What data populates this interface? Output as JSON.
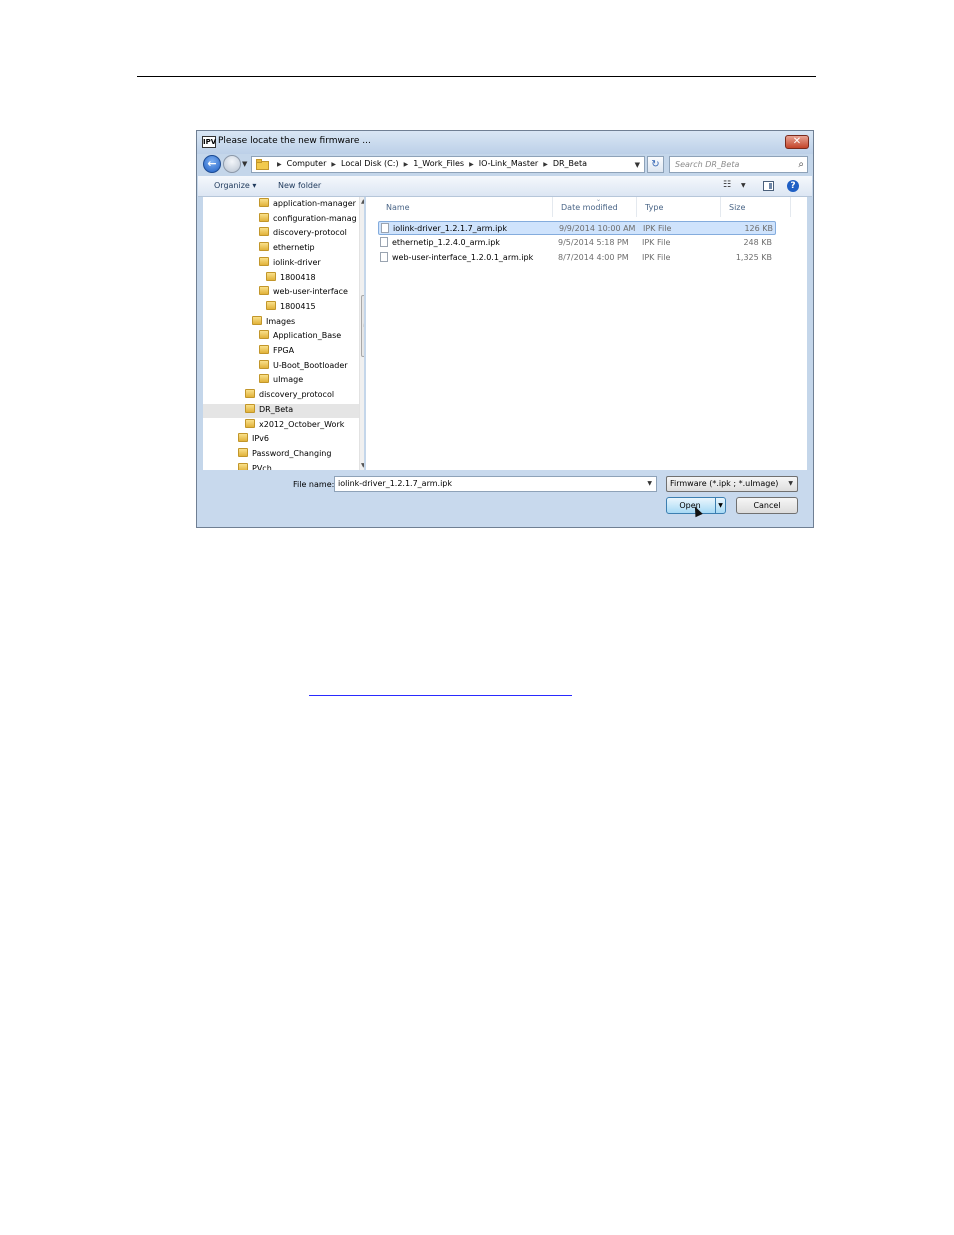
{
  "window": {
    "app_icon_text": "IPV",
    "title": "Please locate the new firmware ...",
    "close_glyph": "✕"
  },
  "nav": {
    "back_glyph": "←",
    "address_crumbs": [
      "Computer",
      "Local Disk (C:)",
      "1_Work_Files",
      "IO-Link_Master",
      "DR_Beta"
    ],
    "search_placeholder": "Search DR_Beta"
  },
  "toolbar": {
    "organize_label": "Organize ▾",
    "new_folder_label": "New folder",
    "help_glyph": "?"
  },
  "tree": {
    "items": [
      {
        "label": "application-manager",
        "indent": 3,
        "selected": false
      },
      {
        "label": "configuration-manag",
        "indent": 3,
        "selected": false
      },
      {
        "label": "discovery-protocol",
        "indent": 3,
        "selected": false
      },
      {
        "label": "ethernetip",
        "indent": 3,
        "selected": false
      },
      {
        "label": "iolink-driver",
        "indent": 3,
        "selected": false
      },
      {
        "label": "1800418",
        "indent": 4,
        "selected": false
      },
      {
        "label": "web-user-interface",
        "indent": 3,
        "selected": false
      },
      {
        "label": "1800415",
        "indent": 4,
        "selected": false
      },
      {
        "label": "Images",
        "indent": 2,
        "selected": false
      },
      {
        "label": "Application_Base",
        "indent": 3,
        "selected": false
      },
      {
        "label": "FPGA",
        "indent": 3,
        "selected": false
      },
      {
        "label": "U-Boot_Bootloader",
        "indent": 3,
        "selected": false
      },
      {
        "label": "uImage",
        "indent": 3,
        "selected": false
      },
      {
        "label": "discovery_protocol",
        "indent": 1,
        "selected": false
      },
      {
        "label": "DR_Beta",
        "indent": 1,
        "selected": true
      },
      {
        "label": "x2012_October_Work",
        "indent": 1,
        "selected": false
      },
      {
        "label": "IPv6",
        "indent": 0,
        "selected": false
      },
      {
        "label": "Password_Changing",
        "indent": 0,
        "selected": false
      },
      {
        "label": "PVch",
        "indent": 0,
        "selected": false
      }
    ]
  },
  "files": {
    "columns": [
      "Name",
      "Date modified",
      "Type",
      "Size"
    ],
    "rows": [
      {
        "name": "iolink-driver_1.2.1.7_arm.ipk",
        "date": "9/9/2014 10:00 AM",
        "type": "IPK File",
        "size": "126 KB",
        "selected": true
      },
      {
        "name": "ethernetip_1.2.4.0_arm.ipk",
        "date": "9/5/2014 5:18 PM",
        "type": "IPK File",
        "size": "248 KB",
        "selected": false
      },
      {
        "name": "web-user-interface_1.2.0.1_arm.ipk",
        "date": "8/7/2014 4:00 PM",
        "type": "IPK File",
        "size": "1,325 KB",
        "selected": false
      }
    ]
  },
  "footer": {
    "file_name_label": "File name:",
    "file_name_value": "iolink-driver_1.2.1.7_arm.ipk",
    "filter_value": "Firmware (*.ipk ; *.uImage)",
    "open_label": "Open",
    "cancel_label": "Cancel"
  }
}
